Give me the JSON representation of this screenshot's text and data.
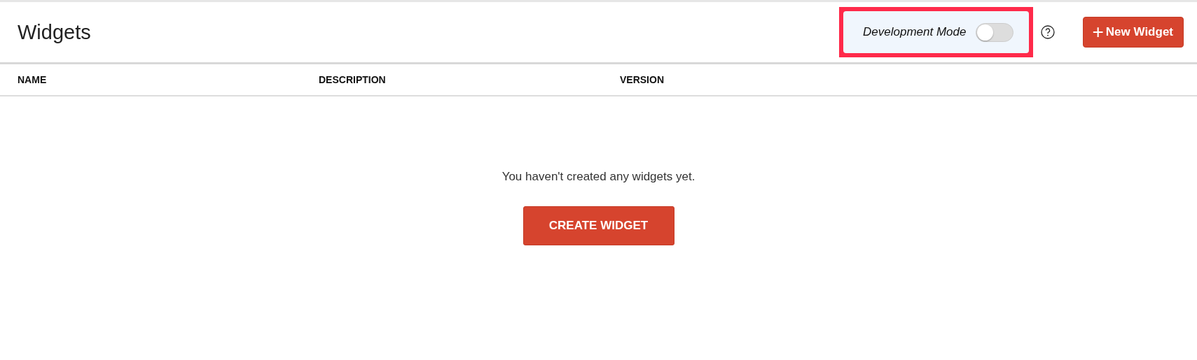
{
  "header": {
    "title": "Widgets",
    "dev_mode": {
      "label": "Development Mode",
      "on": false,
      "highlighted": true
    },
    "new_button": {
      "icon": "+",
      "label": "New Widget"
    }
  },
  "table": {
    "columns": [
      "NAME",
      "DESCRIPTION",
      "VERSION"
    ]
  },
  "empty_state": {
    "message": "You haven't created any widgets yet.",
    "button": "CREATE WIDGET"
  }
}
